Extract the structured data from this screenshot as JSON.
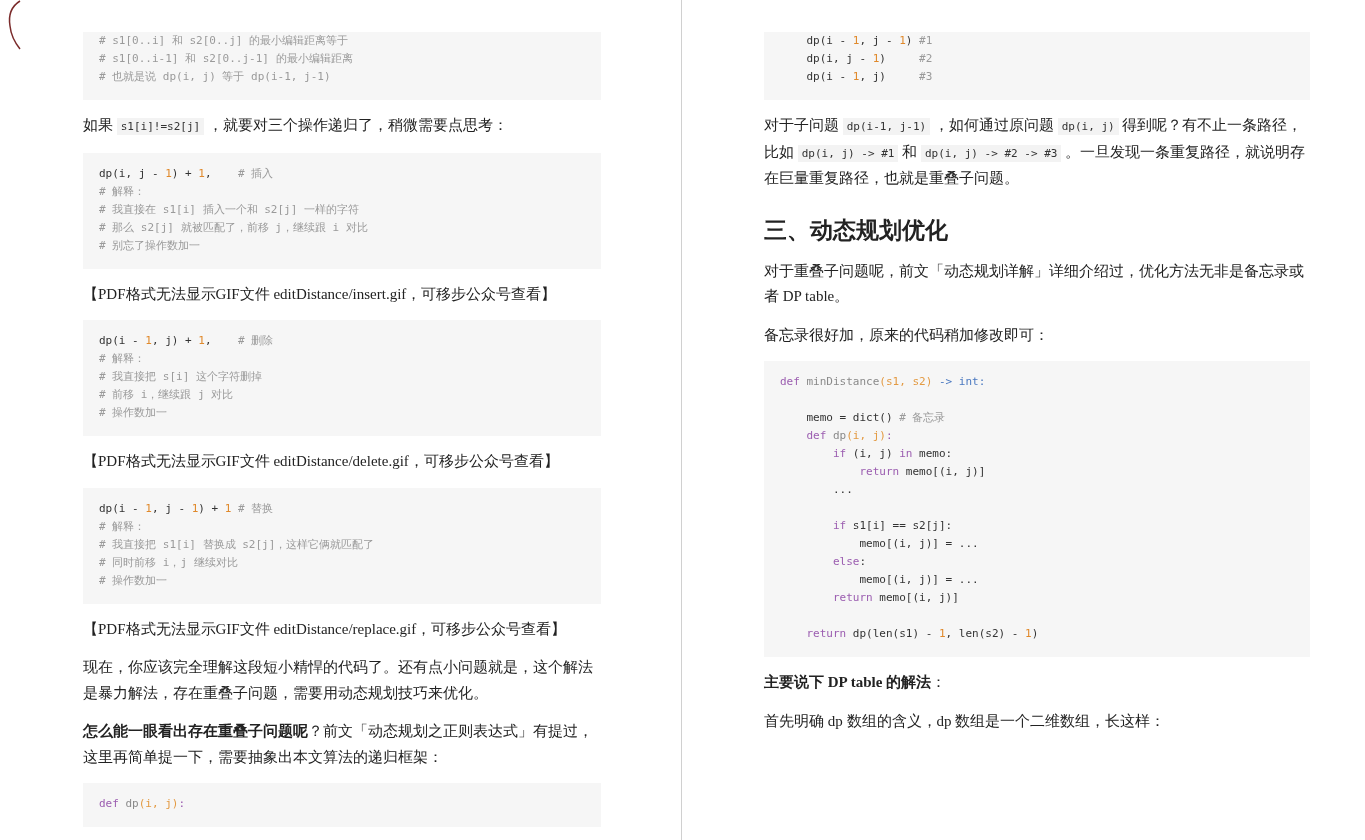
{
  "pages": [
    {
      "blocks": [
        {
          "kind": "code",
          "continued": true,
          "lines": [
            {
              "kind": "code",
              "tokens": [
                {
                  "kind": "comment",
                  "text": "# s1[0..i] 和 s2[0..j] 的最小编辑距离等于"
                }
              ]
            },
            {
              "kind": "code",
              "tokens": [
                {
                  "kind": "comment",
                  "text": "# s1[0..i-1] 和 s2[0..j-1] 的最小编辑距离"
                }
              ]
            },
            {
              "kind": "code",
              "tokens": [
                {
                  "kind": "comment",
                  "text": "# 也就是说 dp(i, j) 等于 dp(i-1, j-1)"
                }
              ]
            }
          ]
        },
        {
          "kind": "paragraph",
          "parts": [
            {
              "kind": "text",
              "text": "如果 "
            },
            {
              "kind": "code",
              "text": "s1[i]!=s2[j]"
            },
            {
              "kind": "text",
              "text": " ，就要对三个操作递归了，稍微需要点思考："
            }
          ]
        },
        {
          "kind": "code",
          "continued": false,
          "lines": [
            {
              "kind": "code",
              "tokens": [
                {
                  "kind": "plain",
                  "text": "dp(i, j - "
                },
                {
                  "kind": "num",
                  "text": "1"
                },
                {
                  "kind": "plain",
                  "text": ") + "
                },
                {
                  "kind": "num",
                  "text": "1"
                },
                {
                  "kind": "plain",
                  "text": ",    "
                },
                {
                  "kind": "comment",
                  "text": "# 插入"
                }
              ]
            },
            {
              "kind": "code",
              "tokens": [
                {
                  "kind": "comment",
                  "text": "# 解释："
                }
              ]
            },
            {
              "kind": "code",
              "tokens": [
                {
                  "kind": "comment",
                  "text": "# 我直接在 s1[i] 插入一个和 s2[j] 一样的字符"
                }
              ]
            },
            {
              "kind": "code",
              "tokens": [
                {
                  "kind": "comment",
                  "text": "# 那么 s2[j] 就被匹配了，前移 j，继续跟 i 对比"
                }
              ]
            },
            {
              "kind": "code",
              "tokens": [
                {
                  "kind": "comment",
                  "text": "# 别忘了操作数加一"
                }
              ]
            }
          ]
        },
        {
          "kind": "placeholder",
          "text": "【PDF格式无法显示GIF文件 editDistance/insert.gif，可移步公众号查看】"
        },
        {
          "kind": "code",
          "continued": false,
          "lines": [
            {
              "kind": "code",
              "tokens": [
                {
                  "kind": "plain",
                  "text": "dp(i - "
                },
                {
                  "kind": "num",
                  "text": "1"
                },
                {
                  "kind": "plain",
                  "text": ", j) + "
                },
                {
                  "kind": "num",
                  "text": "1"
                },
                {
                  "kind": "plain",
                  "text": ",    "
                },
                {
                  "kind": "comment",
                  "text": "# 删除"
                }
              ]
            },
            {
              "kind": "code",
              "tokens": [
                {
                  "kind": "comment",
                  "text": "# 解释："
                }
              ]
            },
            {
              "kind": "code",
              "tokens": [
                {
                  "kind": "comment",
                  "text": "# 我直接把 s[i] 这个字符删掉"
                }
              ]
            },
            {
              "kind": "code",
              "tokens": [
                {
                  "kind": "comment",
                  "text": "# 前移 i，继续跟 j 对比"
                }
              ]
            },
            {
              "kind": "code",
              "tokens": [
                {
                  "kind": "comment",
                  "text": "# 操作数加一"
                }
              ]
            }
          ]
        },
        {
          "kind": "placeholder",
          "text": "【PDF格式无法显示GIF文件 editDistance/delete.gif，可移步公众号查看】"
        },
        {
          "kind": "code",
          "continued": false,
          "lines": [
            {
              "kind": "code",
              "tokens": [
                {
                  "kind": "plain",
                  "text": "dp(i - "
                },
                {
                  "kind": "num",
                  "text": "1"
                },
                {
                  "kind": "plain",
                  "text": ", j - "
                },
                {
                  "kind": "num",
                  "text": "1"
                },
                {
                  "kind": "plain",
                  "text": ") + "
                },
                {
                  "kind": "num",
                  "text": "1"
                },
                {
                  "kind": "comment",
                  "text": " # 替换"
                }
              ]
            },
            {
              "kind": "code",
              "tokens": [
                {
                  "kind": "comment",
                  "text": "# 解释："
                }
              ]
            },
            {
              "kind": "code",
              "tokens": [
                {
                  "kind": "comment",
                  "text": "# 我直接把 s1[i] 替换成 s2[j]，这样它俩就匹配了"
                }
              ]
            },
            {
              "kind": "code",
              "tokens": [
                {
                  "kind": "comment",
                  "text": "# 同时前移 i，j 继续对比"
                }
              ]
            },
            {
              "kind": "code",
              "tokens": [
                {
                  "kind": "comment",
                  "text": "# 操作数加一"
                }
              ]
            }
          ]
        },
        {
          "kind": "placeholder",
          "text": "【PDF格式无法显示GIF文件 editDistance/replace.gif，可移步公众号查看】"
        },
        {
          "kind": "paragraph",
          "parts": [
            {
              "kind": "text",
              "text": "现在，你应该完全理解这段短小精悍的代码了。还有点小问题就是，这个解法是暴力解法，存在重叠子问题，需要用动态规划技巧来优化。"
            }
          ]
        },
        {
          "kind": "paragraph",
          "parts": [
            {
              "kind": "text",
              "text": "**怎么能一眼看出存在重叠子问题呢**？前文「动态规划之正则表达式」有提过，这里再简单提一下，需要抽象出本文算法的递归框架："
            }
          ]
        },
        {
          "kind": "code",
          "continued": false,
          "lines": [
            {
              "kind": "code",
              "tokens": [
                {
                  "kind": "keyword",
                  "text": "def "
                },
                {
                  "kind": "function",
                  "text": "dp"
                },
                {
                  "kind": "param",
                  "text": "(i, j)"
                },
                {
                  "kind": "keyword",
                  "text": ":"
                }
              ]
            }
          ]
        }
      ]
    },
    {
      "blocks": [
        {
          "kind": "code",
          "continued": true,
          "lines": [
            {
              "kind": "code",
              "tokens": [
                {
                  "kind": "plain",
                  "text": "    dp(i - "
                },
                {
                  "kind": "num",
                  "text": "1"
                },
                {
                  "kind": "plain",
                  "text": ", j - "
                },
                {
                  "kind": "num",
                  "text": "1"
                },
                {
                  "kind": "plain",
                  "text": ") "
                },
                {
                  "kind": "comment",
                  "text": "#1"
                }
              ]
            },
            {
              "kind": "code",
              "tokens": [
                {
                  "kind": "plain",
                  "text": "    dp(i, j - "
                },
                {
                  "kind": "num",
                  "text": "1"
                },
                {
                  "kind": "plain",
                  "text": ")     "
                },
                {
                  "kind": "comment",
                  "text": "#2"
                }
              ]
            },
            {
              "kind": "code",
              "tokens": [
                {
                  "kind": "plain",
                  "text": "    dp(i - "
                },
                {
                  "kind": "num",
                  "text": "1"
                },
                {
                  "kind": "plain",
                  "text": ", j)     "
                },
                {
                  "kind": "comment",
                  "text": "#3"
                }
              ]
            }
          ]
        },
        {
          "kind": "paragraph",
          "parts": [
            {
              "kind": "text",
              "text": "对于子问题 "
            },
            {
              "kind": "code",
              "text": "dp(i-1, j-1)"
            },
            {
              "kind": "text",
              "text": " ，如何通过原问题 "
            },
            {
              "kind": "code",
              "text": "dp(i, j)"
            },
            {
              "kind": "text",
              "text": " 得到呢？有不止一条路径，比如 "
            },
            {
              "kind": "code",
              "text": "dp(i, j) -> #1"
            },
            {
              "kind": "text",
              "text": " 和 "
            },
            {
              "kind": "code",
              "text": "dp(i, j) -> #2 -> #3"
            },
            {
              "kind": "text",
              "text": " 。一旦发现一条重复路径，就说明存在巨量重复路径，也就是重叠子问题。"
            }
          ]
        },
        {
          "kind": "heading",
          "text": "三、动态规划优化"
        },
        {
          "kind": "paragraph",
          "parts": [
            {
              "kind": "text",
              "text": "对于重叠子问题呢，前文「动态规划详解」详细介绍过，优化方法无非是备忘录或者 DP table。"
            }
          ]
        },
        {
          "kind": "paragraph",
          "parts": [
            {
              "kind": "text",
              "text": "备忘录很好加，原来的代码稍加修改即可："
            }
          ]
        },
        {
          "kind": "code",
          "continued": false,
          "lines": [
            {
              "kind": "code",
              "tokens": [
                {
                  "kind": "keyword",
                  "text": "def "
                },
                {
                  "kind": "function",
                  "text": "minDistance"
                },
                {
                  "kind": "param",
                  "text": "(s1, s2)"
                },
                {
                  "kind": "type",
                  "text": " -> int:"
                }
              ]
            },
            {
              "kind": "blank"
            },
            {
              "kind": "code",
              "tokens": [
                {
                  "kind": "plain",
                  "text": "    memo = dict() "
                },
                {
                  "kind": "comment",
                  "text": "# 备忘录"
                }
              ]
            },
            {
              "kind": "code",
              "tokens": [
                {
                  "kind": "keyword",
                  "text": "    def "
                },
                {
                  "kind": "function",
                  "text": "dp"
                },
                {
                  "kind": "param",
                  "text": "(i, j)"
                },
                {
                  "kind": "keyword",
                  "text": ":"
                }
              ]
            },
            {
              "kind": "code",
              "tokens": [
                {
                  "kind": "keyword",
                  "text": "        if"
                },
                {
                  "kind": "plain",
                  "text": " (i, j) "
                },
                {
                  "kind": "keyword",
                  "text": "in"
                },
                {
                  "kind": "plain",
                  "text": " memo:"
                }
              ]
            },
            {
              "kind": "code",
              "tokens": [
                {
                  "kind": "keyword",
                  "text": "            return"
                },
                {
                  "kind": "plain",
                  "text": " memo[(i, j)]"
                }
              ]
            },
            {
              "kind": "code",
              "tokens": [
                {
                  "kind": "plain",
                  "text": "        ..."
                }
              ]
            },
            {
              "kind": "blank"
            },
            {
              "kind": "code",
              "tokens": [
                {
                  "kind": "keyword",
                  "text": "        if"
                },
                {
                  "kind": "plain",
                  "text": " s1[i] == s2[j]:"
                }
              ]
            },
            {
              "kind": "code",
              "tokens": [
                {
                  "kind": "plain",
                  "text": "            memo[(i, j)] = ..."
                }
              ]
            },
            {
              "kind": "code",
              "tokens": [
                {
                  "kind": "keyword",
                  "text": "        else"
                },
                {
                  "kind": "plain",
                  "text": ":"
                }
              ]
            },
            {
              "kind": "code",
              "tokens": [
                {
                  "kind": "plain",
                  "text": "            memo[(i, j)] = ..."
                }
              ]
            },
            {
              "kind": "code",
              "tokens": [
                {
                  "kind": "keyword",
                  "text": "        return"
                },
                {
                  "kind": "plain",
                  "text": " memo[(i, j)]"
                }
              ]
            },
            {
              "kind": "blank"
            },
            {
              "kind": "code",
              "tokens": [
                {
                  "kind": "keyword",
                  "text": "    return"
                },
                {
                  "kind": "plain",
                  "text": " dp(len(s1) - "
                },
                {
                  "kind": "num",
                  "text": "1"
                },
                {
                  "kind": "plain",
                  "text": ", len(s2) - "
                },
                {
                  "kind": "num",
                  "text": "1"
                },
                {
                  "kind": "plain",
                  "text": ")"
                }
              ]
            }
          ]
        },
        {
          "kind": "paragraph",
          "parts": [
            {
              "kind": "text",
              "text": "**主要说下 DP table 的解法**："
            }
          ]
        },
        {
          "kind": "paragraph",
          "parts": [
            {
              "kind": "text",
              "text": "首先明确 dp 数组的含义，dp 数组是一个二维数组，长这样："
            }
          ]
        }
      ]
    }
  ]
}
